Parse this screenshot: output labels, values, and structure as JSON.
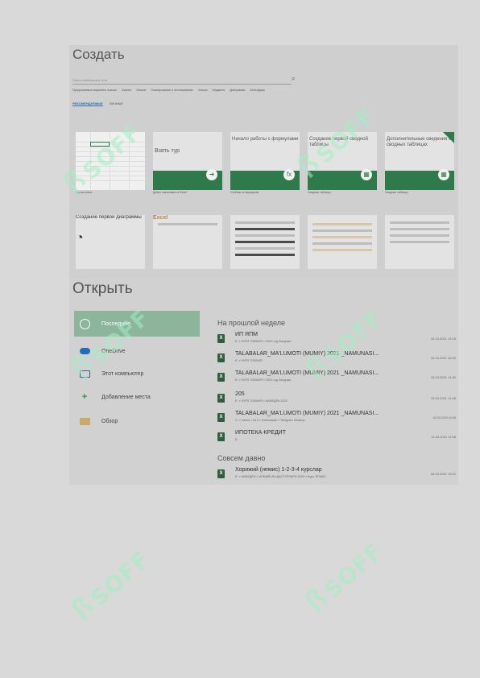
{
  "create": {
    "title": "Создать",
    "search_placeholder": "Поиск шаблонов в сети",
    "categories": [
      "Предлагаемые варианты поиска:",
      "Бизнес",
      "Личное",
      "Планирование и отслеживание",
      "Списки",
      "Бюджеты",
      "Диаграммы",
      "Календари"
    ],
    "subtabs": [
      "РЕКОМЕНДУЕМЫЕ",
      "ЛИЧНЫЕ"
    ],
    "templates": [
      {
        "caption": "",
        "label": "Пустая книга"
      },
      {
        "caption": "Взять тур",
        "label": "Добро пожаловать в Excel"
      },
      {
        "caption": "Начало работы с формулами",
        "label": "Учебник по формулам"
      },
      {
        "caption": "Создание первой сводной таблицы",
        "label": "Сводные таблицы"
      },
      {
        "caption": "Дополнительные сведения о сводных таблицах",
        "label": "Сводные таблицы"
      }
    ],
    "row2": [
      {
        "caption": "Создание первой диаграммы"
      },
      {
        "caption": "Excel"
      },
      {
        "caption": ""
      },
      {
        "caption": ""
      },
      {
        "caption": ""
      }
    ]
  },
  "open": {
    "title": "Открыть",
    "locations": [
      {
        "label": "Последние",
        "icon": "clock-icon"
      },
      {
        "label": "OneDrive",
        "icon": "cloud-icon"
      },
      {
        "label": "Этот компьютер",
        "icon": "computer-icon"
      },
      {
        "label": "Добавление места",
        "icon": "plus-icon"
      },
      {
        "label": "Обзор",
        "icon": "folder-icon"
      }
    ],
    "section_last_week": "На прошлой неделе",
    "section_older": "Совсем давно",
    "files": [
      {
        "name": "ИП ЯПМ",
        "path": "E: » КУРЗ ТОВЧИЯ » 2020 год Загрузки",
        "date": "15.03.2021 13:18"
      },
      {
        "name": "TALABALAR_MA'LUMOTI (MUMIY) 2021 _NAMUNASI...",
        "path": "E: » КУРЗ ТОВЧИЯ",
        "date": "15.03.2021 16:00"
      },
      {
        "name": "TALABALAR_MA'LUMOTI (MUMIY) 2021 _NAMUNASI...",
        "path": "E: » КУРЗ ТОВЧИЯ » 2020 год Загрузки",
        "date": "15.03.2021 14:30"
      },
      {
        "name": "205",
        "path": "E: » КУРЗ ТОВЧИЯ » КАФЕДРА 2022",
        "date": "15.03.2021 14:08"
      },
      {
        "name": "TALABALAR_MA'LUMOTI (MUMIY) 2021 _NAMUNASI...",
        "path": "C: » Users » Б13 » Downloads » Telegram Desktop",
        "date": "15.03.2021 8:35"
      },
      {
        "name": "ИПОТЕКА-КРЕДИТ",
        "path": "E:",
        "date": "12.03.2021 11:56"
      }
    ],
    "older_files": [
      {
        "name": "Хорижий (немис) 1-2-3-4 курслар",
        "path": "E: » КАФЕДРА » ИЛМИЙ ИШ ДАСТУРЛАРИ 2020 » Курс ЯПМКС",
        "date": "08.03.2021 13:02"
      }
    ]
  },
  "watermark": "SOFF"
}
